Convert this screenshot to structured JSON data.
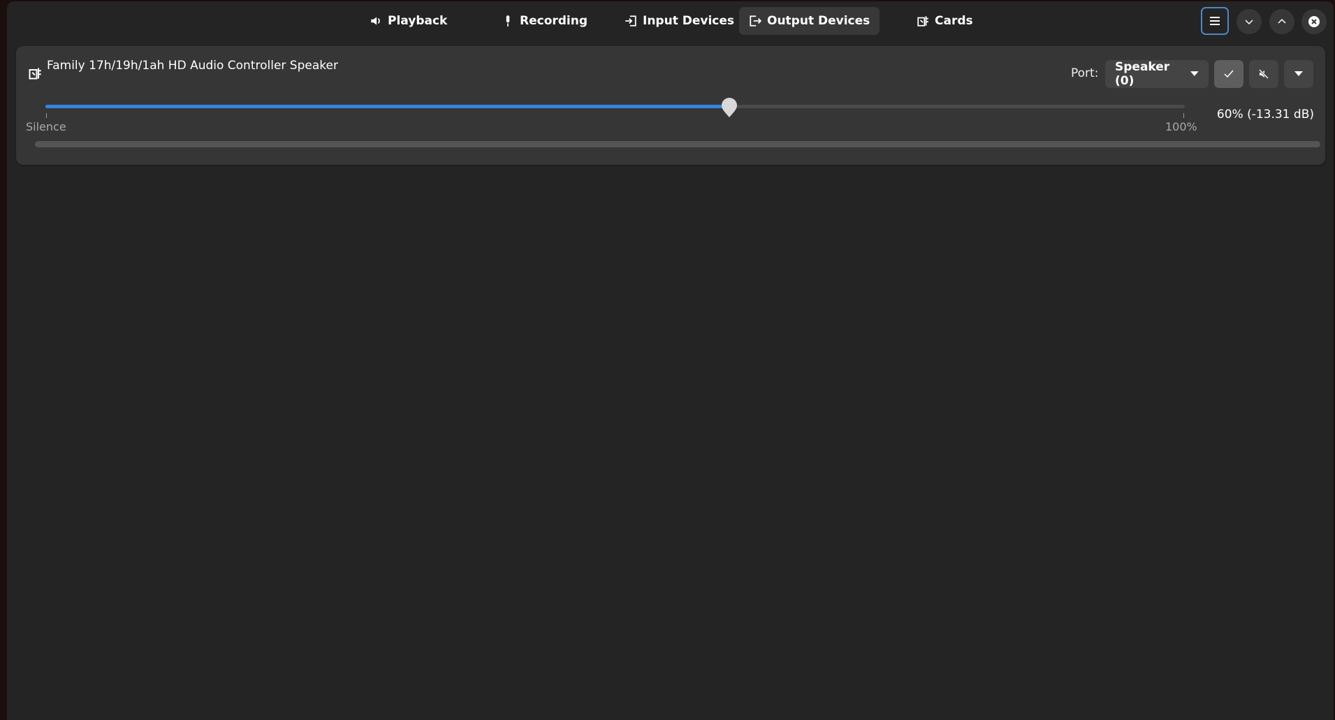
{
  "tabs": [
    {
      "label": "Playback",
      "icon": "speaker-icon"
    },
    {
      "label": "Recording",
      "icon": "microphone-icon"
    },
    {
      "label": "Input Devices",
      "icon": "input-icon"
    },
    {
      "label": "Output Devices",
      "icon": "output-icon",
      "active": true
    },
    {
      "label": "Cards",
      "icon": "card-icon"
    }
  ],
  "device": {
    "name": "Family 17h/19h/1ah HD Audio Controller Speaker",
    "port_label": "Port:",
    "port_value": "Speaker (0)",
    "volume_percent": 60,
    "volume_text": "60% (-13.31 dB)",
    "scale_min_label": "Silence",
    "scale_max_label": "100%",
    "default_set": true,
    "muted": false,
    "level": 0
  },
  "colors": {
    "accent": "#3584e4",
    "window_bg": "#242424",
    "card_bg": "#363636"
  }
}
